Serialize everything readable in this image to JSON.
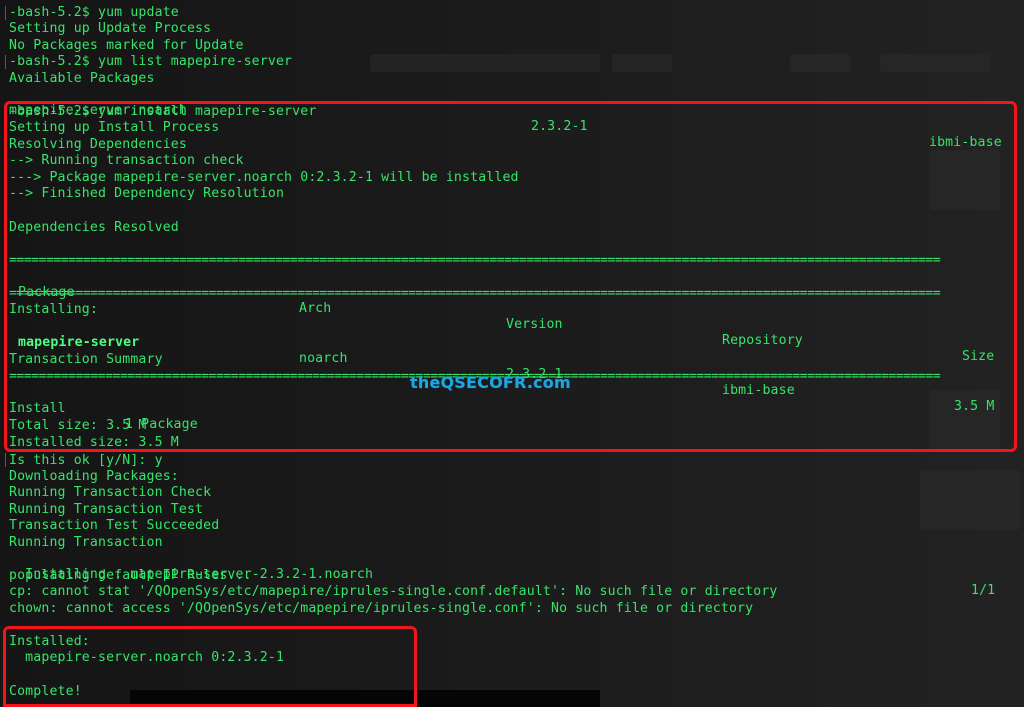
{
  "terminal": {
    "prompt": "-bash-5.2$",
    "lines_top": [
      "-bash-5.2$ yum update",
      "Setting up Update Process",
      "No Packages marked for Update",
      "-bash-5.2$ yum list mapepire-server",
      "Available Packages"
    ],
    "list_row": {
      "name": "mapepire-server.noarch",
      "version": "2.3.2-1",
      "repo": "ibmi-base"
    },
    "install_block": [
      "-bash-5.2$ yum install mapepire-server",
      "Setting up Install Process",
      "Resolving Dependencies",
      "--> Running transaction check",
      "---> Package mapepire-server.noarch 0:2.3.2-1 will be installed",
      "--> Finished Dependency Resolution",
      "",
      "Dependencies Resolved"
    ],
    "separator": "==============================================================================================================================",
    "table": {
      "headers": {
        "package": "Package",
        "arch": "Arch",
        "version": "Version",
        "repository": "Repository",
        "size": "Size"
      },
      "installing_label": "Installing:",
      "row": {
        "package": "mapepire-server",
        "arch": "noarch",
        "version": "2.3.2-1",
        "repository": "ibmi-base",
        "size": "3.5 M"
      }
    },
    "summary": {
      "title": "Transaction Summary",
      "install_label": "Install",
      "install_count": "1 Package",
      "total_size": "Total size: 3.5 M",
      "installed_size": "Installed size: 3.5 M"
    },
    "lines_after": [
      "Is this ok [y/N]: y",
      "Downloading Packages:",
      "Running Transaction Check",
      "Running Transaction Test",
      "Transaction Test Succeeded",
      "Running Transaction"
    ],
    "installing_progress": {
      "text": "  Installing : mapepire-server-2.3.2-1.noarch",
      "count": "1/1"
    },
    "lines_errors": [
      "populating default IP Rules...",
      "cp: cannot stat '/QOpenSys/etc/mapepire/iprules-single.conf.default': No such file or directory",
      "chown: cannot access '/QOpenSys/etc/mapepire/iprules-single.conf': No such file or directory"
    ],
    "installed_block": {
      "label": "Installed:",
      "package": "  mapepire-server.noarch 0:2.3.2-1",
      "complete": "Complete!"
    }
  },
  "watermark": "theQSECOFR.com",
  "colors": {
    "terminal_text": "#37e46a",
    "highlight_box": "#f1161c",
    "watermark": "#1da7e0",
    "background": "#141414"
  }
}
